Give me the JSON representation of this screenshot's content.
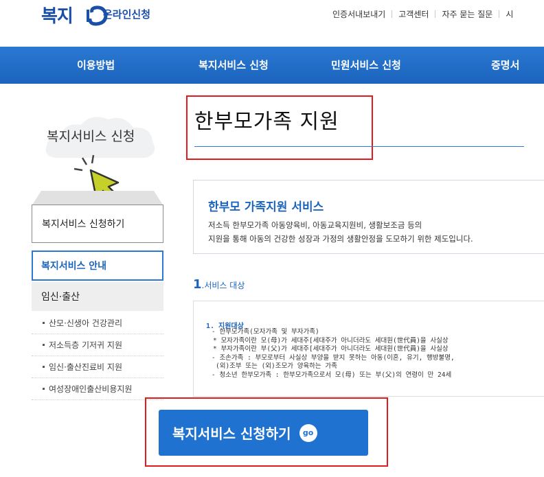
{
  "header": {
    "logo_text": "복지",
    "logo_sub": "온라인신청",
    "util_links": [
      "인증서내보내기",
      "고객센터",
      "자주 묻는 질문",
      "시"
    ]
  },
  "nav": {
    "items": [
      "이용방법",
      "복지서비스 신청",
      "민원서비스 신청",
      "증명서"
    ]
  },
  "sidebar": {
    "title": "복지서비스 신청",
    "apply_label": "복지서비스 신청하기",
    "guide_label": "복지서비스 안내",
    "category": "임신·출산",
    "sub_items": [
      "산모·신생아 건강관리",
      "저소득층 기저귀 지원",
      "임신·출산진료비 지원",
      "여성장애인출산비용지원"
    ]
  },
  "main": {
    "page_title": "한부모가족 지원",
    "service_title": "한부모 가족지원 서비스",
    "service_desc_1": "저소득 한부모가족 아동양육비, 아동교육지원비, 생활보조금 등의",
    "service_desc_2": "지원을 통해 아동의 건강한 성장과 가정의 생활안정을 도모하기 위한 제도입니다.",
    "section_number": "1",
    "section_label": ".서비스 대상",
    "detail_heading": "1. 지원대상",
    "detail_lines": [
      "- 한부모가족(모자가족 및 부자가족)",
      "* 모자가족이란 모(母)가 세대주[세대주가 아니더라도 세대원(世代員)을 사실상",
      "* 부자가족이란 부(父)가 세대주[세대주가 아니더라도 세대원(世代員)을 사실상",
      "- 조손가족 : 부모로부터 사실상 부양을 받지 못하는 아동(이혼, 유기, 행방불명,",
      "(외)조부 또는 (외)조모가 양육하는 가족",
      "- 청소년 한부모가족 : 한부모가족으로서 모(母) 또는 부(父)의 연령이 만 24세"
    ]
  },
  "cta": {
    "label": "복지서비스 신청하기",
    "go_icon_text": "go"
  },
  "colors": {
    "brand_blue": "#1b64bd",
    "nav_blue": "#2a78d2",
    "highlight_red": "#e4191e"
  }
}
